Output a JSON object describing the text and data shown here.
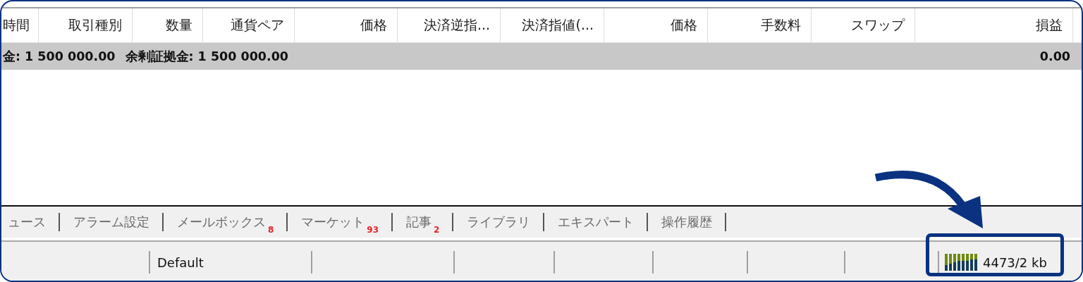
{
  "table": {
    "columns": [
      {
        "label": "時間"
      },
      {
        "label": "取引種別"
      },
      {
        "label": "数量"
      },
      {
        "label": "通貨ペア"
      },
      {
        "label": "価格"
      },
      {
        "label": "決済逆指..."
      },
      {
        "label": "決済指値(..."
      },
      {
        "label": "価格"
      },
      {
        "label": "手数料"
      },
      {
        "label": "スワップ"
      },
      {
        "label": "損益"
      }
    ],
    "summary": {
      "items": [
        "金: 1 500 000.00",
        "余剰証拠金: 1 500 000.00"
      ],
      "profit": "0.00"
    }
  },
  "tabs": [
    {
      "label": "ュース"
    },
    {
      "label": "アラーム設定"
    },
    {
      "label": "メールボックス",
      "badge": "8"
    },
    {
      "label": "マーケット",
      "badge": "93"
    },
    {
      "label": "記事",
      "badge": "2"
    },
    {
      "label": "ライブラリ"
    },
    {
      "label": "エキスパート"
    },
    {
      "label": "操作履歴"
    }
  ],
  "status_bar": {
    "profile": "Default",
    "traffic": "4473/2 kb"
  }
}
